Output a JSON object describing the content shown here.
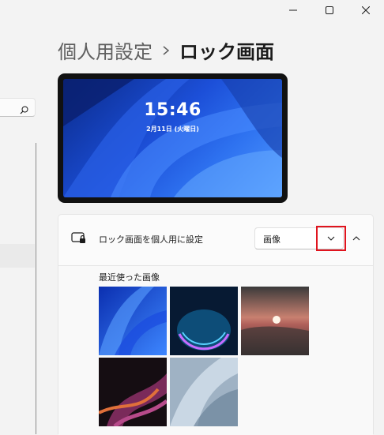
{
  "window": {
    "minimize_icon": "minimize-icon",
    "maximize_icon": "maximize-icon",
    "close_icon": "close-icon"
  },
  "nav": {
    "search_icon": "search-icon"
  },
  "breadcrumb": {
    "parent": "個人用設定",
    "separator_icon": "chevron-right-icon",
    "current": "ロック画面"
  },
  "preview": {
    "time": "15:46",
    "date": "2月11日 (火曜日)"
  },
  "lock_screen_setting": {
    "icon": "lock-screen-icon",
    "label": "ロック画面を個人用に設定",
    "dropdown_value": "画像",
    "dropdown_icon": "chevron-down-icon",
    "collapse_icon": "chevron-up-icon"
  },
  "recent_images": {
    "label": "最近使った画像",
    "items": [
      {
        "name": "blue-bloom-image"
      },
      {
        "name": "dark-glow-image"
      },
      {
        "name": "sunset-lake-image"
      },
      {
        "name": "purple-ribbon-image"
      },
      {
        "name": "gray-bloom-image"
      }
    ]
  },
  "colors": {
    "accent_highlight": "#e0141e",
    "background": "#f3f3f3",
    "card": "#fbfbfb"
  }
}
